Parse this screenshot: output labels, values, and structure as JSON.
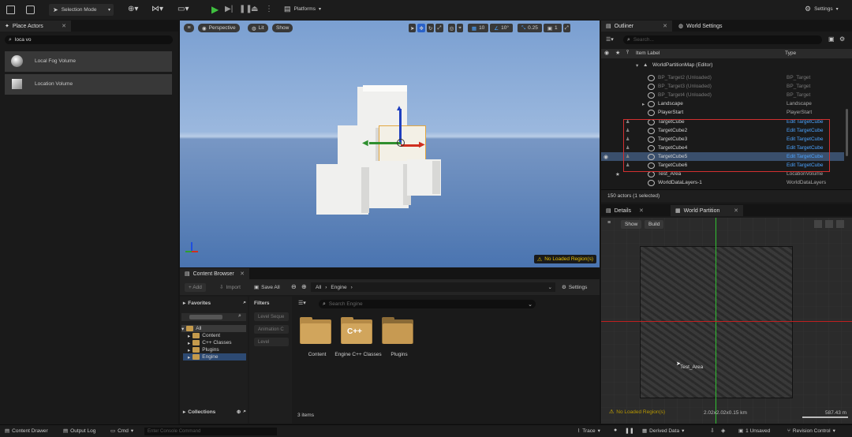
{
  "toolbar": {
    "selection_mode": "Selection Mode",
    "platforms": "Platforms",
    "settings": "Settings"
  },
  "place_actors": {
    "tab": "Place Actors",
    "search_value": "loca vo",
    "items": [
      "Local Fog Volume",
      "Location Volume"
    ]
  },
  "viewport": {
    "perspective": "Perspective",
    "lit": "Lit",
    "show": "Show",
    "grid_snap": "10",
    "rot_snap": "10°",
    "scale_snap": "0.25",
    "camera_speed": "1",
    "warning": "No Loaded Region(s)"
  },
  "content_browser": {
    "tab": "Content Browser",
    "add": "+ Add",
    "import": "Import",
    "save_all": "Save All",
    "breadcrumb": [
      "All",
      "Engine"
    ],
    "settings": "Settings",
    "favorites": "Favorites",
    "project_name": "",
    "tree": [
      "All",
      "Content",
      "C++ Classes",
      "Plugins",
      "Engine"
    ],
    "filters": "Filters",
    "filter_items": [
      "Level Seque",
      "Animation C",
      "Level"
    ],
    "search_placeholder": "Search Engine",
    "folders": [
      "Content",
      "Engine C++ Classes",
      "Plugins"
    ],
    "cpp_badge": "C++",
    "count": "3 items",
    "collections": "Collections"
  },
  "outliner": {
    "tab": "Outliner",
    "world_settings_tab": "World Settings",
    "search_placeholder": "Search...",
    "col_label": "Item Label",
    "col_type": "Type",
    "root": "WorldPartitionMap (Editor)",
    "rows": [
      {
        "label": "BP_Target2 (Unloaded)",
        "type": "BP_Target",
        "faint": true
      },
      {
        "label": "BP_Target3 (Unloaded)",
        "type": "BP_Target",
        "faint": true
      },
      {
        "label": "BP_Target4 (Unloaded)",
        "type": "BP_Target",
        "faint": true
      },
      {
        "label": "Landscape",
        "type": "Landscape"
      },
      {
        "label": "PlayerStart",
        "type": "PlayerStart"
      },
      {
        "label": "TargetCube",
        "type": "Edit TargetCube"
      },
      {
        "label": "TargetCube2",
        "type": "Edit TargetCube"
      },
      {
        "label": "TargetCube3",
        "type": "Edit TargetCube"
      },
      {
        "label": "TargetCube4",
        "type": "Edit TargetCube"
      },
      {
        "label": "TargetCube5",
        "type": "Edit TargetCube"
      },
      {
        "label": "TargetCube6",
        "type": "Edit TargetCube"
      },
      {
        "label": "Test_Area",
        "type": "LocationVolume"
      },
      {
        "label": "WorldDataLayers-1",
        "type": "WorldDataLayers"
      }
    ],
    "status": "150 actors (1 selected)"
  },
  "details": {
    "tab": "Details",
    "wp_tab": "World Partition",
    "show": "Show",
    "build": "Build",
    "area_label": "Test_Area",
    "warning": "No Loaded Region(s)",
    "size": "2.02x2.02x0.15 km",
    "scale": "587.43 m"
  },
  "statusbar": {
    "content_drawer": "Content Drawer",
    "output_log": "Output Log",
    "cmd": "Cmd",
    "console_placeholder": "Enter Console Command",
    "trace": "Trace",
    "derived_data": "Derived Data",
    "unsaved": "1 Unsaved",
    "revision": "Revision Control"
  },
  "colors": {
    "accent_blue": "#4ba3ff",
    "warning": "#e8c000",
    "highlight_red": "#d23030",
    "play_green": "#3fbf3f"
  }
}
